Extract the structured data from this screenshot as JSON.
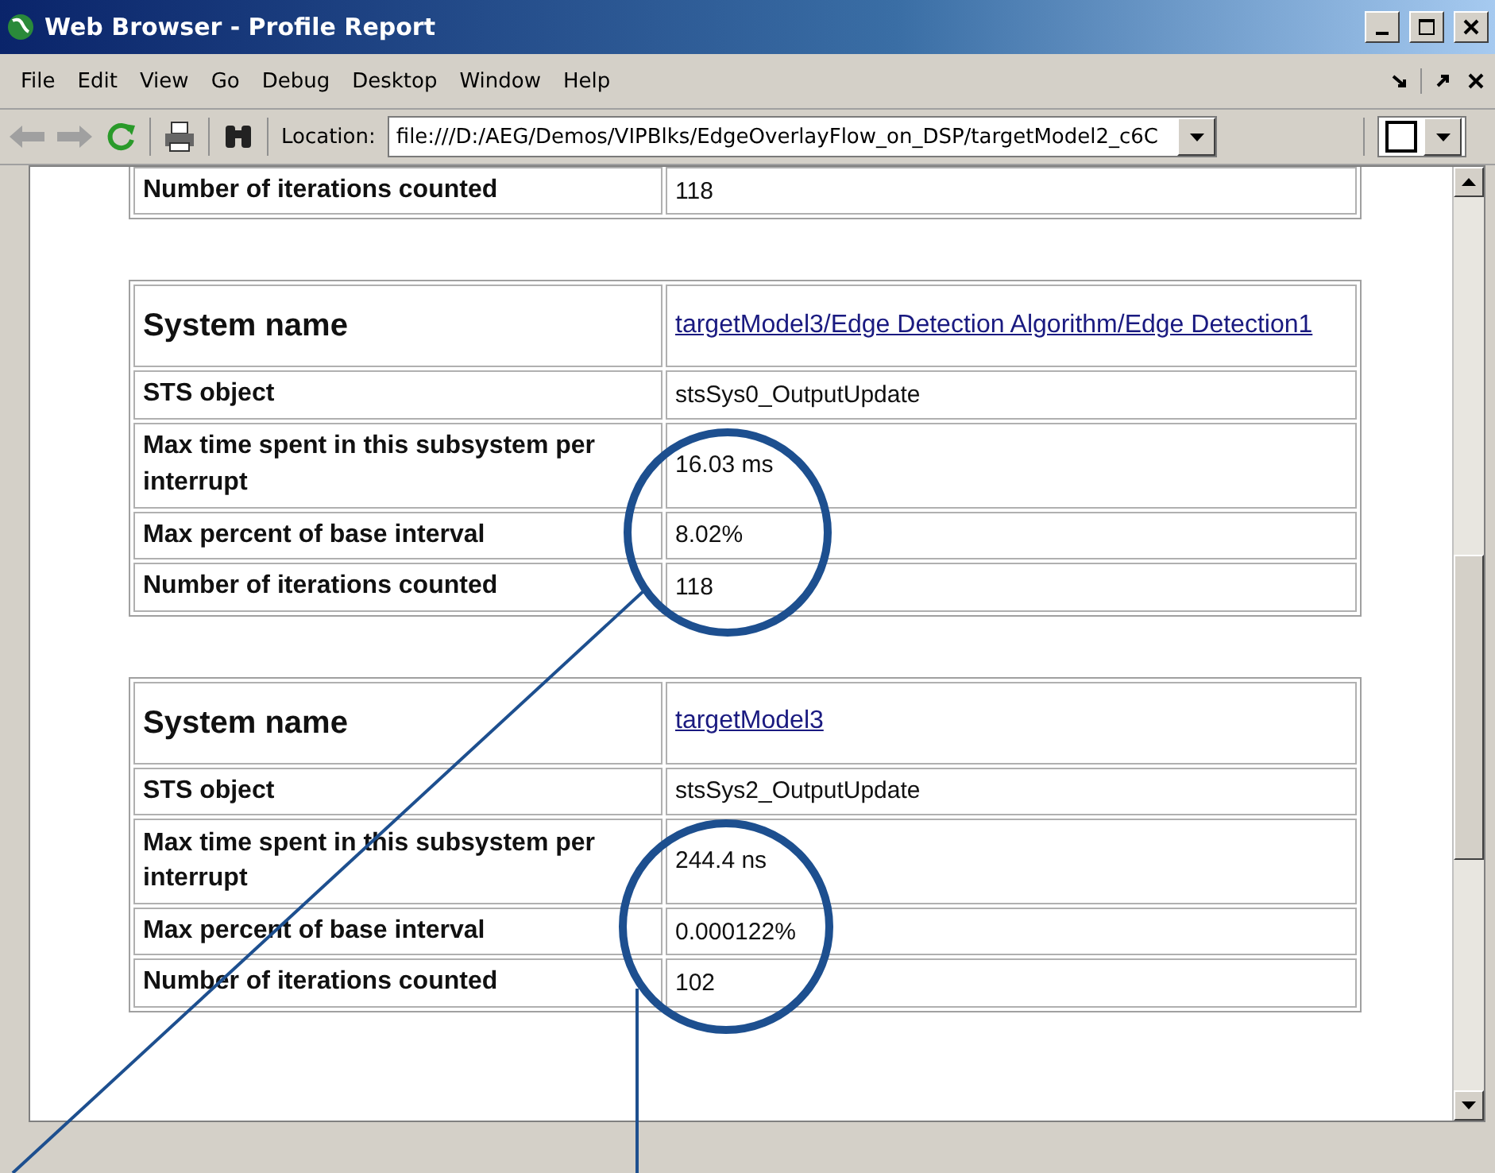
{
  "window": {
    "title": "Web Browser - Profile Report"
  },
  "menu": [
    "File",
    "Edit",
    "View",
    "Go",
    "Debug",
    "Desktop",
    "Window",
    "Help"
  ],
  "toolbar": {
    "location_label": "Location:",
    "location": "file:///D:/AEG/Demos/VIPBlks/EdgeOverlayFlow_on_DSP/targetModel2_c6C"
  },
  "tables": [
    {
      "rows": [
        {
          "kind": "plain",
          "label": "Number of iterations counted",
          "value": "118"
        }
      ]
    },
    {
      "rows": [
        {
          "kind": "name",
          "label": "System name",
          "value": "targetModel3/Edge Detection Algorithm/Edge Detection1"
        },
        {
          "kind": "plain",
          "label": "STS object",
          "value": "stsSys0_OutputUpdate"
        },
        {
          "kind": "tall",
          "label": "Max time spent in this subsystem per interrupt",
          "value": "16.03 ms"
        },
        {
          "kind": "plain",
          "label": "Max percent of base interval",
          "value": "8.02%"
        },
        {
          "kind": "plain",
          "label": "Number of iterations counted",
          "value": "118"
        }
      ]
    },
    {
      "rows": [
        {
          "kind": "name",
          "label": "System name",
          "value": "targetModel3"
        },
        {
          "kind": "plain",
          "label": "STS object",
          "value": "stsSys2_OutputUpdate"
        },
        {
          "kind": "tall",
          "label": "Max time spent in this subsystem per interrupt",
          "value": "244.4 ns"
        },
        {
          "kind": "plain",
          "label": "Max percent of base interval",
          "value": "0.000122%"
        },
        {
          "kind": "plain",
          "label": "Number of iterations counted",
          "value": "102"
        }
      ]
    }
  ]
}
